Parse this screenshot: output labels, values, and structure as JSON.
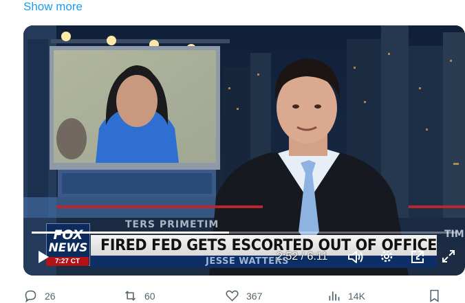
{
  "tweet": {
    "show_more": "Show more"
  },
  "video": {
    "headline": "FIRED FED GETS ESCORTED OUT OF OFFICE",
    "network_line1": "FOX",
    "network_line2": "NEWS",
    "clock": "7:27 CT",
    "host_name": "JESSE WATTERS",
    "bg_label": "TERS PRIMETIM",
    "bg_label_right": "TIM",
    "timecode": "2:52 / 6:11",
    "progress": 0.4636,
    "colors": {
      "banner": "#e6e6e6",
      "lower_third": "#0e2f66",
      "fox_blue": "#0d2a5c",
      "red": "#b31217"
    }
  },
  "controls": {
    "play_icon": "play-icon",
    "volume_icon": "volume-icon",
    "settings_icon": "gear-icon",
    "pip_icon": "pip-icon",
    "fullscreen_icon": "fullscreen-icon"
  },
  "actions": {
    "replies": "26",
    "reposts": "60",
    "likes": "367",
    "views": "14K"
  },
  "accent": "#1d9bf0"
}
